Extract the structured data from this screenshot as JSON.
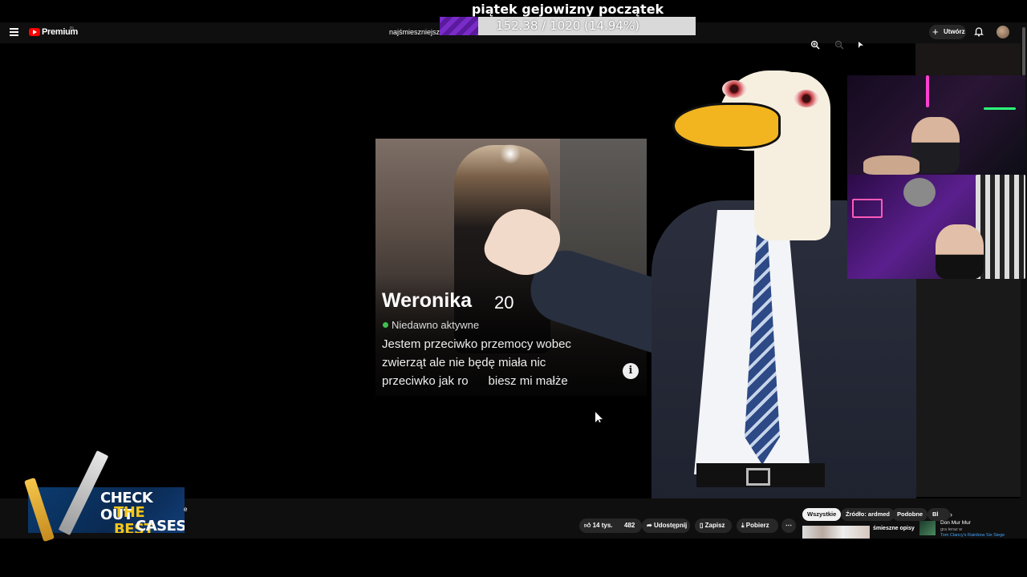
{
  "overlay": {
    "title": "piątek gejowizny początek",
    "goal_text": "152.38 / 1020 (14.94%)",
    "goal_fraction": 0.1494,
    "goal_fill_color": "#7a2cc9"
  },
  "header": {
    "brand": "Premium",
    "brand_sup": "PL",
    "search_query": "najśmieszniejsze",
    "create_label": "Utwórz",
    "icons": [
      "menu-icon",
      "youtube-logo",
      "bell-icon",
      "avatar",
      "zoom-in-icon",
      "zoom-out-icon"
    ]
  },
  "card": {
    "name": "Weronika",
    "age": "20",
    "status": "Niedawno aktywne",
    "bio_lines": [
      "Jestem przeciwko przemocy wobec",
      "zwierząt ale nie będę miała nic",
      "przeciwko jak ro      biesz mi małże"
    ],
    "info_icon": "i"
  },
  "actions": {
    "like": "14 tys.",
    "dislike_count": "482",
    "share": "Udostępnij",
    "save": "Zapisz",
    "download": "Pobierz",
    "more": "⋯"
  },
  "filters": {
    "all": "Wszystkie",
    "source": "Źródło: ardmed",
    "similar": "Podobne",
    "cut": "Bl"
  },
  "suggestion": {
    "title": "śmieszne opisy"
  },
  "notification": {
    "name": "Don Mur Mur",
    "line1": "gra teraz w",
    "line2": "Tom Clancy's Rainbow Six Siege"
  },
  "promo": {
    "line1": "CHECK OUT",
    "line2": "THE BEST",
    "line3": "CASES",
    "tail": "e"
  },
  "colors": {
    "youtube_red": "#ff0000",
    "background": "#000000",
    "header_bg": "#0f0f0f",
    "promo_yellow": "#f5c518"
  }
}
